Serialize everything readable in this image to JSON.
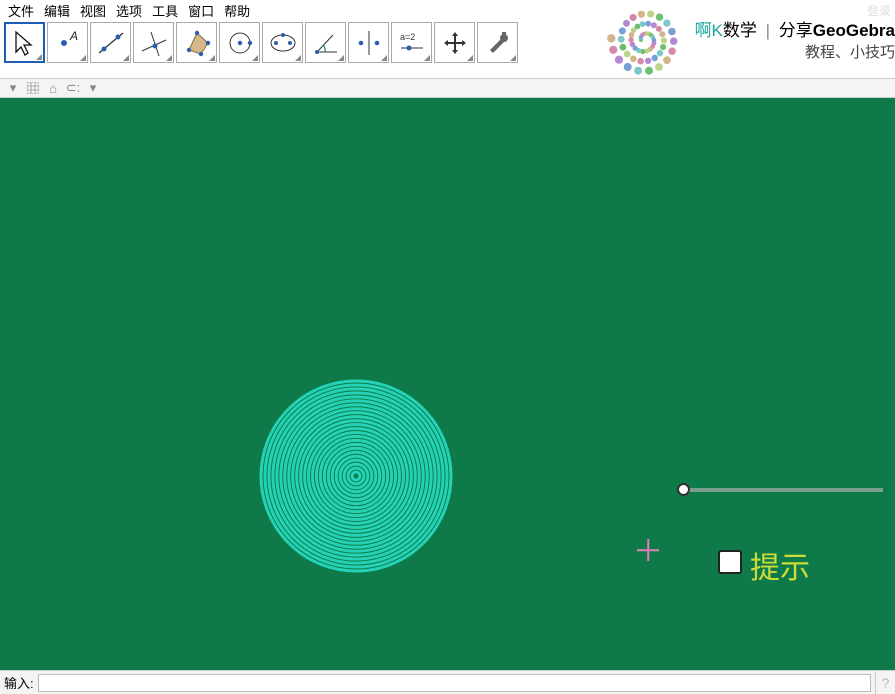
{
  "menu": {
    "items": [
      "文件",
      "编辑",
      "视图",
      "选项",
      "工具",
      "窗口",
      "帮助"
    ]
  },
  "login_label": "登录",
  "brand": {
    "ak": "啊K",
    "math": "数学",
    "share_prefix": "分享",
    "share_bold": "GeoGebra",
    "line2": "教程、小技巧"
  },
  "tools": {
    "names": [
      "move",
      "point",
      "line",
      "perpendicular",
      "polygon",
      "circle",
      "conic",
      "angle",
      "reflect",
      "slider",
      "move-view",
      "settings"
    ]
  },
  "canvas": {
    "hint_label": "提示",
    "checkbox_checked": false,
    "slider_value": 0,
    "rings_count": 24
  },
  "input": {
    "label": "输入:",
    "value": "",
    "placeholder": ""
  }
}
